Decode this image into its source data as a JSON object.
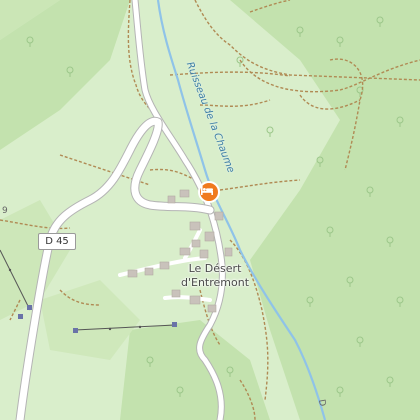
{
  "map": {
    "place_label_line1": "Le Désert",
    "place_label_line2": "d'Entremont",
    "road_ref": "D 45",
    "road_edge_label": "D",
    "river_label": "Ruisseau de la Chaume",
    "edge_label_left": "9",
    "poi": {
      "type": "lodging",
      "icon": "bed-icon",
      "color": "#f07a1e"
    },
    "colors": {
      "meadow": "#d9eecb",
      "forest": "#c3e2ae",
      "road_casing": "#b4b4b4",
      "road_fill": "#ffffff",
      "river": "#8fc3e8",
      "track": "#b08a54",
      "building": "#c9c2bb"
    }
  }
}
